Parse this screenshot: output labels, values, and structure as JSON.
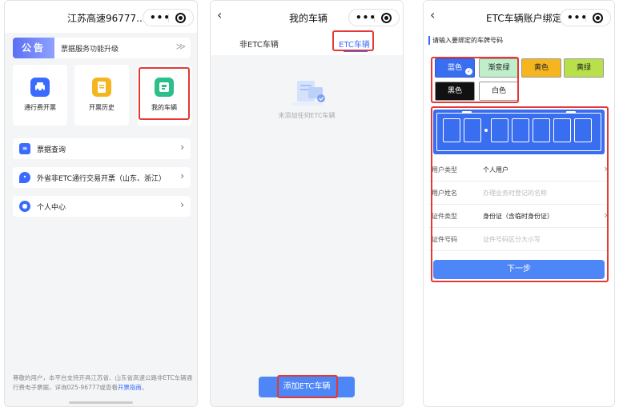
{
  "panel1": {
    "title": "江苏高速96777...",
    "notice": {
      "badge": "公告",
      "text": "票据服务功能升级",
      "arrow": "≫"
    },
    "tiles": [
      {
        "label": "通行费开票",
        "icon": "car-icon",
        "color": "#3a6bff"
      },
      {
        "label": "开票历史",
        "icon": "receipt-icon",
        "color": "#f5b51f"
      },
      {
        "label": "我的车辆",
        "icon": "vehicle-card-icon",
        "color": "#2bbf8a"
      }
    ],
    "rows": [
      {
        "label": "票据查询",
        "icon": "document-search-icon",
        "color": "#3a6bff"
      },
      {
        "label": "外省非ETC通行交易开票（山东、浙江）",
        "icon": "location-pin-icon",
        "color": "#3a6bff"
      },
      {
        "label": "个人中心",
        "icon": "user-icon",
        "color": "#3a6bff"
      }
    ],
    "footer": "尊敬的用户，本平台支持开具江苏省、山东省高速公路非ETC车辆通行费电子票据，详询025-96777或查看",
    "footer_link": "开票指南",
    "footer_end": "。"
  },
  "panel2": {
    "title": "我的车辆",
    "tabs": [
      "非ETC车辆",
      "ETC车辆"
    ],
    "active_tab": "ETC车辆",
    "empty_text": "未添加任何ETC车辆",
    "add_button": "添加ETC车辆"
  },
  "panel3": {
    "title": "ETC车辆账户绑定",
    "hint": "请输入要绑定的车牌号码",
    "plate_colors": [
      {
        "label": "蓝色",
        "bg": "#3a6ef0",
        "fg": "#ffffff",
        "selected": true
      },
      {
        "label": "渐变绿",
        "bg": "#bfeecb",
        "fg": "#222222",
        "selected": false
      },
      {
        "label": "黄色",
        "bg": "#f5b51f",
        "fg": "#222222",
        "selected": false
      },
      {
        "label": "黄绿",
        "bg": "#b7e04a",
        "fg": "#222222",
        "selected": false
      },
      {
        "label": "黑色",
        "bg": "#111111",
        "fg": "#ffffff",
        "selected": false
      },
      {
        "label": "白色",
        "bg": "#ffffff",
        "fg": "#222222",
        "selected": false
      }
    ],
    "fields": [
      {
        "label": "用户类型",
        "value": "个人用户",
        "placeholder": false,
        "chevron": true
      },
      {
        "label": "用户姓名",
        "value": "办理业务时登记的名称",
        "placeholder": true,
        "chevron": false
      },
      {
        "label": "证件类型",
        "value": "身份证（含临时身份证）",
        "placeholder": false,
        "chevron": true
      },
      {
        "label": "证件号码",
        "value": "证件号码区分大小写",
        "placeholder": true,
        "chevron": false
      }
    ],
    "next_button": "下一步"
  },
  "colors": {
    "accent": "#3a6bff",
    "highlight": "#e53935",
    "button": "#4d86f7"
  }
}
